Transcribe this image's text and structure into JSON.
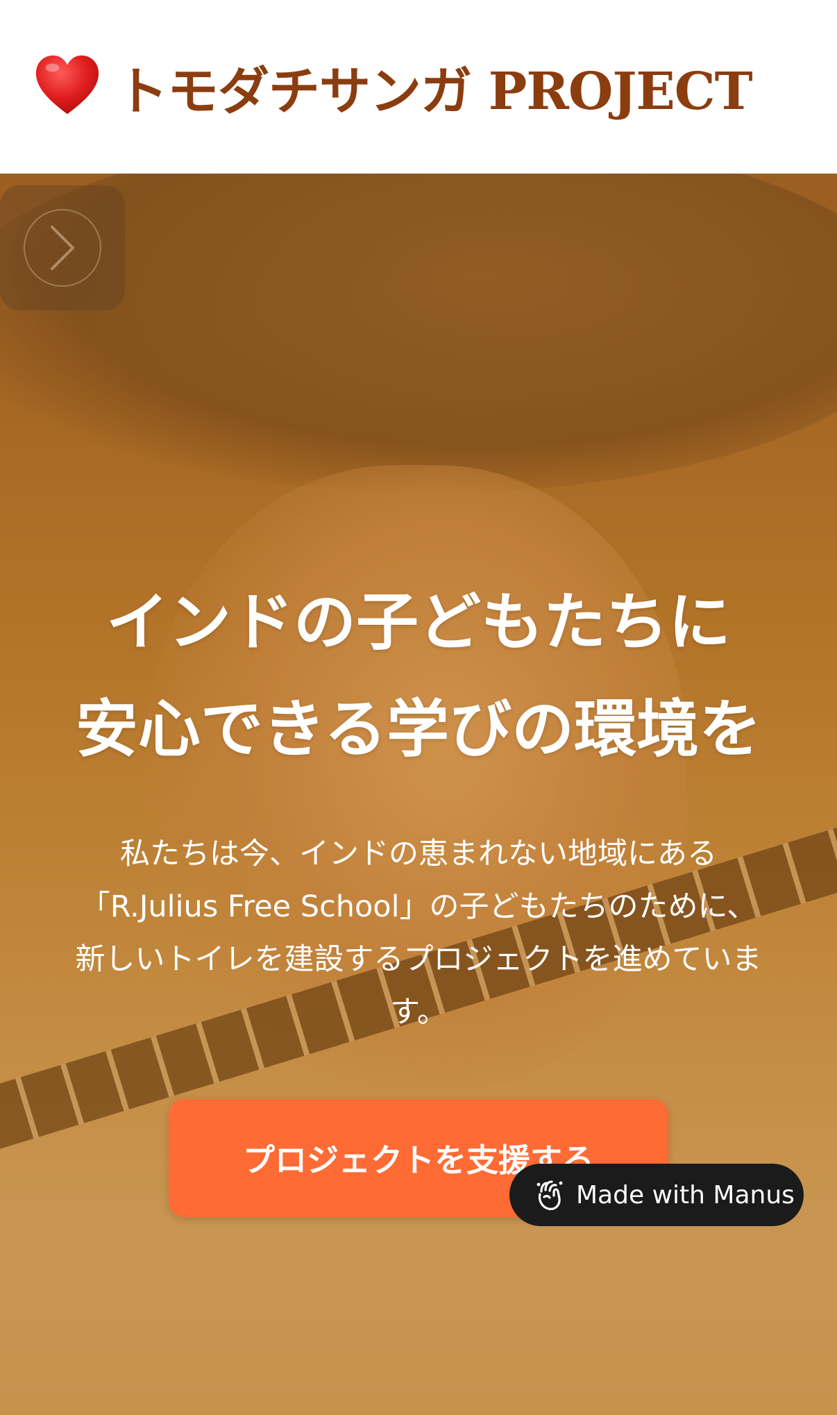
{
  "header": {
    "title": "トモダチサンガ PROJECT",
    "logo_icon": "heart-icon",
    "title_color": "#8b3d10"
  },
  "hero": {
    "slider_icon": "chevron-right-icon",
    "headline": [
      "インドの子どもたちに",
      "安心できる学びの環境を"
    ],
    "description": [
      "私たちは今、インドの恵まれない地域にある",
      "「R.Julius Free School」の子どもたちのために、",
      "新しいトイレを建設するプロジェクトを進めていま",
      "す。"
    ],
    "cta_label": "プロジェクトを支援する",
    "cta_color": "#ff6b35"
  },
  "badge": {
    "label": "Made with Manus",
    "icon": "manus-hand-icon"
  }
}
